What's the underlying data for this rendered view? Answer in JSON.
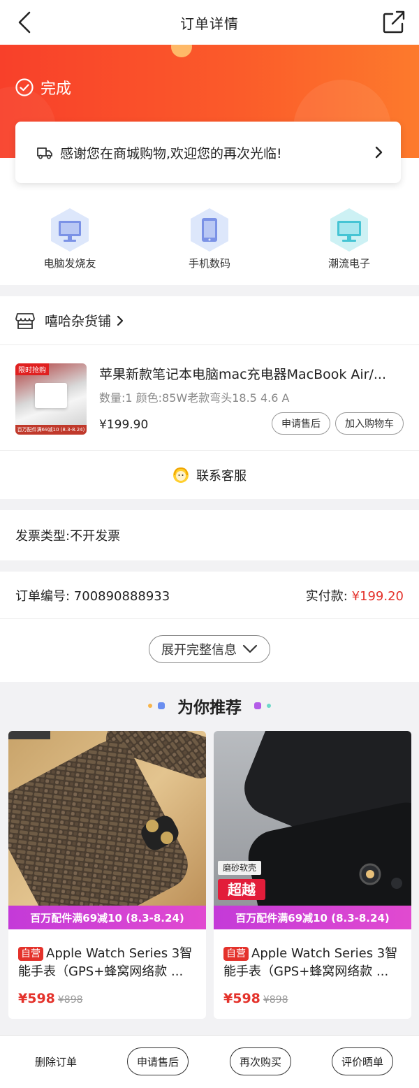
{
  "nav": {
    "title": "订单详情"
  },
  "status": {
    "label": "完成"
  },
  "notice": {
    "text": "感谢您在商城购物,欢迎您的再次光临!"
  },
  "categories": [
    {
      "label": "电脑发烧友",
      "icon": "monitor-icon"
    },
    {
      "label": "手机数码",
      "icon": "phone-icon"
    },
    {
      "label": "潮流电子",
      "icon": "display-icon"
    }
  ],
  "store": {
    "name": "嘻哈杂货铺",
    "product": {
      "title": "苹果新款笔记本电脑mac充电器MacBook Air/...",
      "spec": "数量:1 颜色:85W老款弯头18.5 4.6 A",
      "price": "¥199.90",
      "thumb_tag": "限时抢购",
      "thumb_banner": "百万配件满69减10 (8.3-8.24)",
      "after_sale": "申请售后",
      "add_cart": "加入购物车"
    },
    "contact": "联系客服"
  },
  "invoice": {
    "text": "发票类型:不开发票"
  },
  "order": {
    "number_label": "订单编号: 700890888933",
    "paid_label": "实付款:",
    "paid_value": "¥199.20",
    "expand": "展开完整信息"
  },
  "recommend": {
    "title": "为你推荐",
    "items": [
      {
        "self": "自营",
        "title": "Apple Watch Series 3智能手表（GPS+蜂窝网络款 ...",
        "price": "¥598",
        "old": "¥898",
        "promo": "百万配件满69减10 (8.3-8.24)"
      },
      {
        "self": "自营",
        "title": "Apple Watch Series 3智能手表（GPS+蜂窝网络款 ...",
        "price": "¥598",
        "old": "¥898",
        "promo": "百万配件满69减10 (8.3-8.24)",
        "badge1": "磨砂软壳",
        "badge2": "超越"
      }
    ]
  },
  "bottom": {
    "delete": "删除订单",
    "after_sale": "申请售后",
    "rebuy": "再次购买",
    "review": "评价晒单"
  },
  "colors": {
    "accent": "#f8402a",
    "price": "#e4322b",
    "promo": "#c43ad8"
  }
}
